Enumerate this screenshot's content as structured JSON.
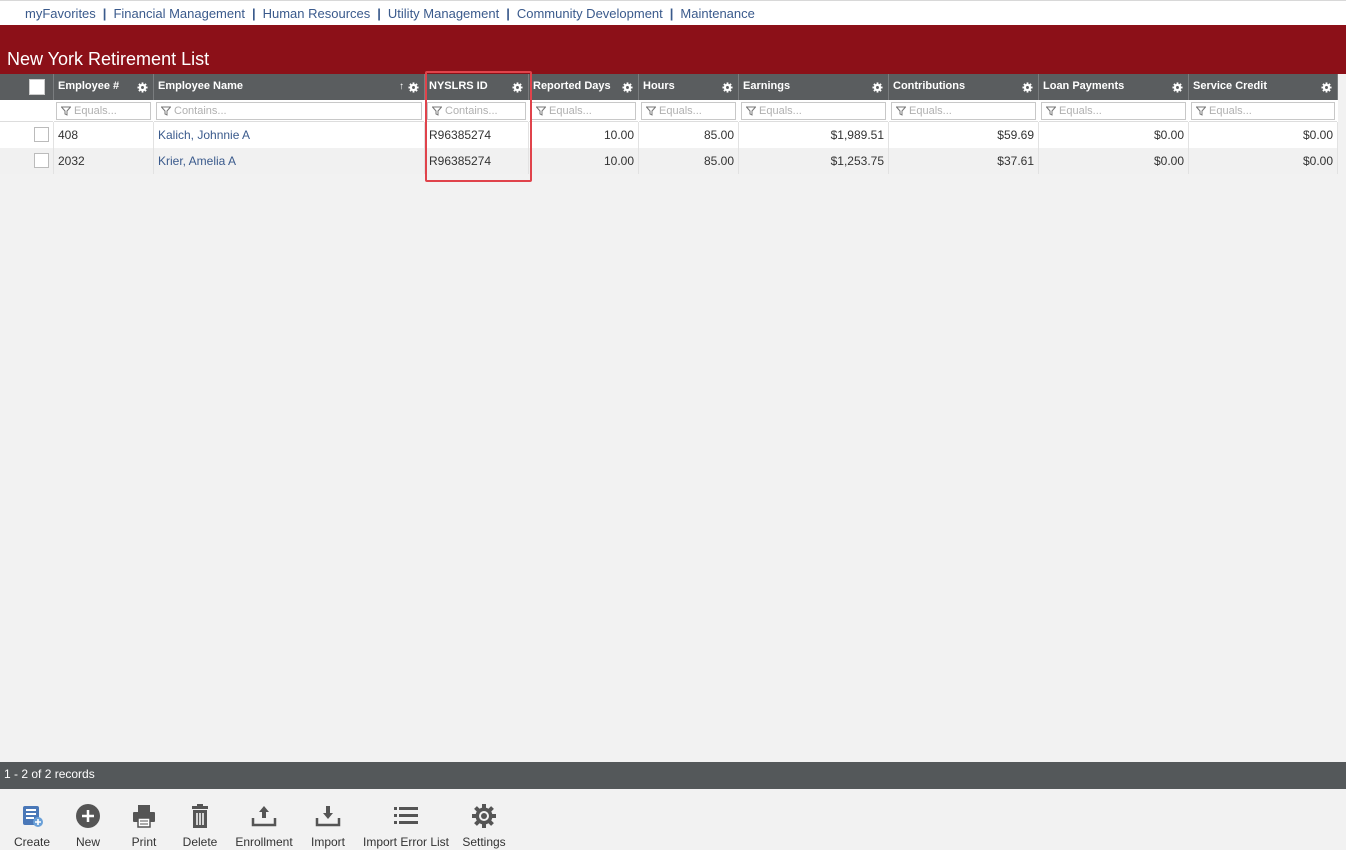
{
  "nav": {
    "items": [
      "myFavorites",
      "Financial Management",
      "Human Resources",
      "Utility Management",
      "Community Development",
      "Maintenance"
    ],
    "separator": "|"
  },
  "page": {
    "title": "New York Retirement List"
  },
  "grid": {
    "columns": [
      {
        "label": "Employee #",
        "filter_placeholder": "Equals...",
        "sort": ""
      },
      {
        "label": "Employee Name",
        "filter_placeholder": "Contains...",
        "sort": "↑"
      },
      {
        "label": "NYSLRS ID",
        "filter_placeholder": "Contains...",
        "sort": ""
      },
      {
        "label": "Reported Days",
        "filter_placeholder": "Equals...",
        "sort": ""
      },
      {
        "label": "Hours",
        "filter_placeholder": "Equals...",
        "sort": ""
      },
      {
        "label": "Earnings",
        "filter_placeholder": "Equals...",
        "sort": ""
      },
      {
        "label": "Contributions",
        "filter_placeholder": "Equals...",
        "sort": ""
      },
      {
        "label": "Loan Payments",
        "filter_placeholder": "Equals...",
        "sort": ""
      },
      {
        "label": "Service Credit",
        "filter_placeholder": "Equals...",
        "sort": ""
      }
    ],
    "rows": [
      [
        "408",
        "Kalich, Johnnie A",
        "R96385274",
        "10.00",
        "85.00",
        "$1,989.51",
        "$59.69",
        "$0.00",
        "$0.00"
      ],
      [
        "2032",
        "Krier, Amelia A",
        "R96385274",
        "10.00",
        "85.00",
        "$1,253.75",
        "$37.61",
        "$0.00",
        "$0.00"
      ]
    ]
  },
  "status": {
    "records": "1 - 2 of 2 records"
  },
  "toolbar": {
    "buttons": [
      {
        "label": "Create",
        "icon": "create-icon"
      },
      {
        "label": "New",
        "icon": "plus-circle-icon"
      },
      {
        "label": "Print",
        "icon": "printer-icon"
      },
      {
        "label": "Delete",
        "icon": "trash-icon"
      },
      {
        "label": "Enrollment",
        "icon": "upload-icon"
      },
      {
        "label": "Import",
        "icon": "download-icon"
      },
      {
        "label": "Import Error List",
        "icon": "list-icon"
      },
      {
        "label": "Settings",
        "icon": "gear-icon"
      }
    ]
  },
  "colors": {
    "title_bar": "#8c1018",
    "header_bg": "#5a5d5f",
    "status_bg": "#54585a",
    "link": "#3a5a8c",
    "highlight": "#e0434b"
  }
}
